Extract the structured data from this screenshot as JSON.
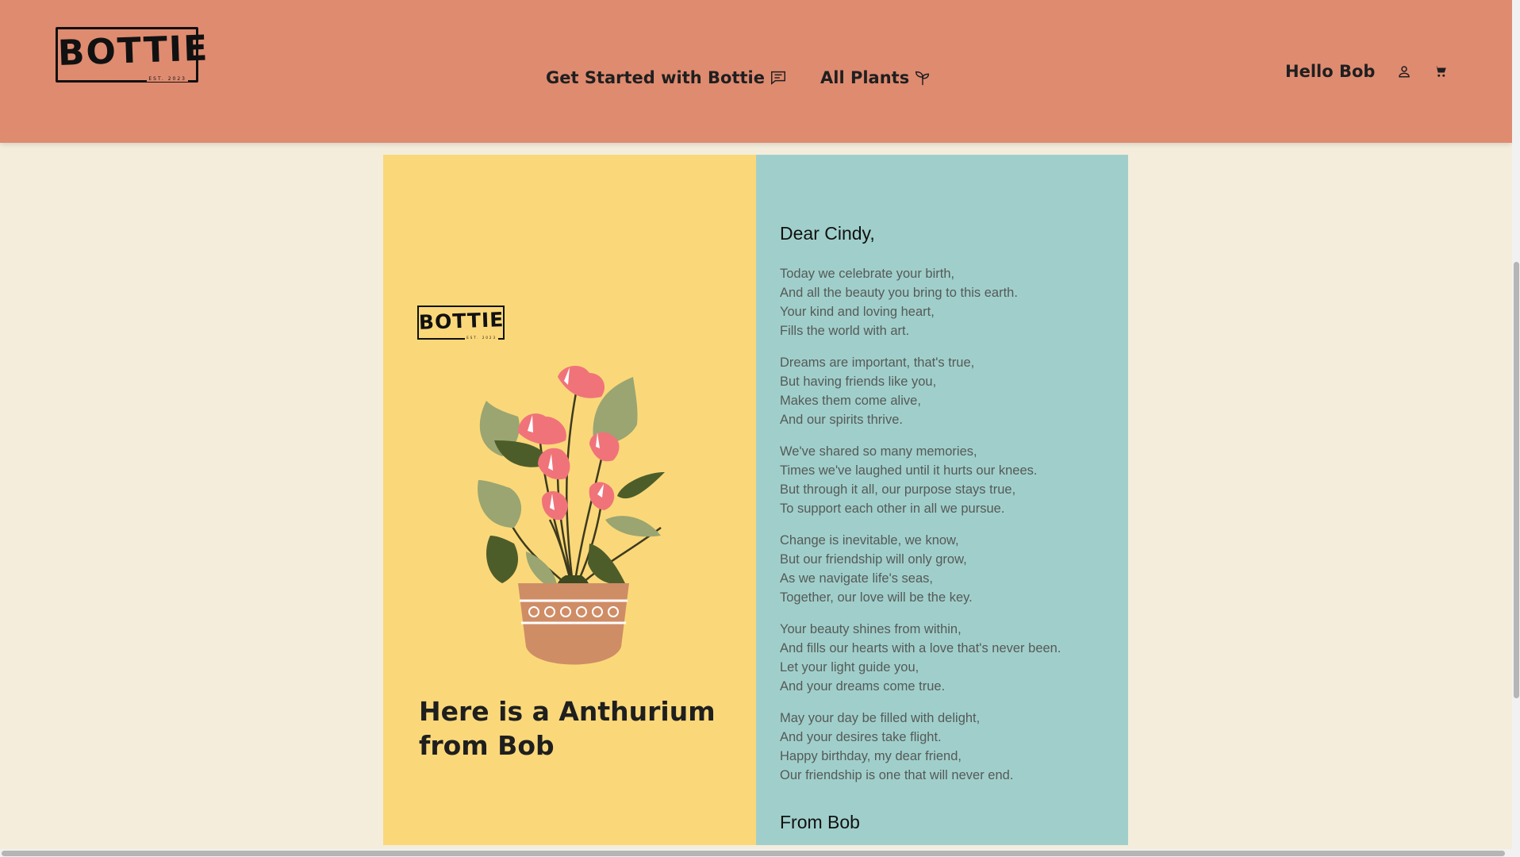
{
  "header": {
    "logo_text": "BOTTIE",
    "logo_sub": "EST. 2023",
    "nav": [
      {
        "label": "Get Started with Bottie",
        "icon": "chat-icon"
      },
      {
        "label": "All Plants",
        "icon": "sprout-icon"
      }
    ],
    "greeting": "Hello Bob",
    "user_icon": "user-icon",
    "cart_icon": "cart-icon"
  },
  "card": {
    "logo_text": "BOTTIE",
    "logo_sub": "EST. 2023",
    "title": "Here is a Anthurium from Bob",
    "salutation": "Dear Cindy,",
    "poem": [
      [
        "Today we celebrate your birth,",
        "And all the beauty you bring to this earth.",
        "Your kind and loving heart,",
        "Fills the world with art."
      ],
      [
        "Dreams are important, that's true,",
        "But having friends like you,",
        "Makes them come alive,",
        "And our spirits thrive."
      ],
      [
        "We've shared so many memories,",
        "Times we've laughed until it hurts our knees.",
        "But through it all, our purpose stays true,",
        "To support each other in all we pursue."
      ],
      [
        "Change is inevitable, we know,",
        "But our friendship will only grow,",
        "As we navigate life's seas,",
        "Together, our love will be the key."
      ],
      [
        "Your beauty shines from within,",
        "And fills our hearts with a love that's never been.",
        "Let your light guide you,",
        "And your dreams come true."
      ],
      [
        "May your day be filled with delight,",
        "And your desires take flight.",
        "Happy birthday, my dear friend,",
        "Our friendship is one that will never end."
      ]
    ],
    "signoff": "From Bob"
  },
  "colors": {
    "header_bg": "#df8b70",
    "page_bg": "#f4eddc",
    "card_left_bg": "#fad879",
    "card_right_bg": "#a0cfcb"
  }
}
